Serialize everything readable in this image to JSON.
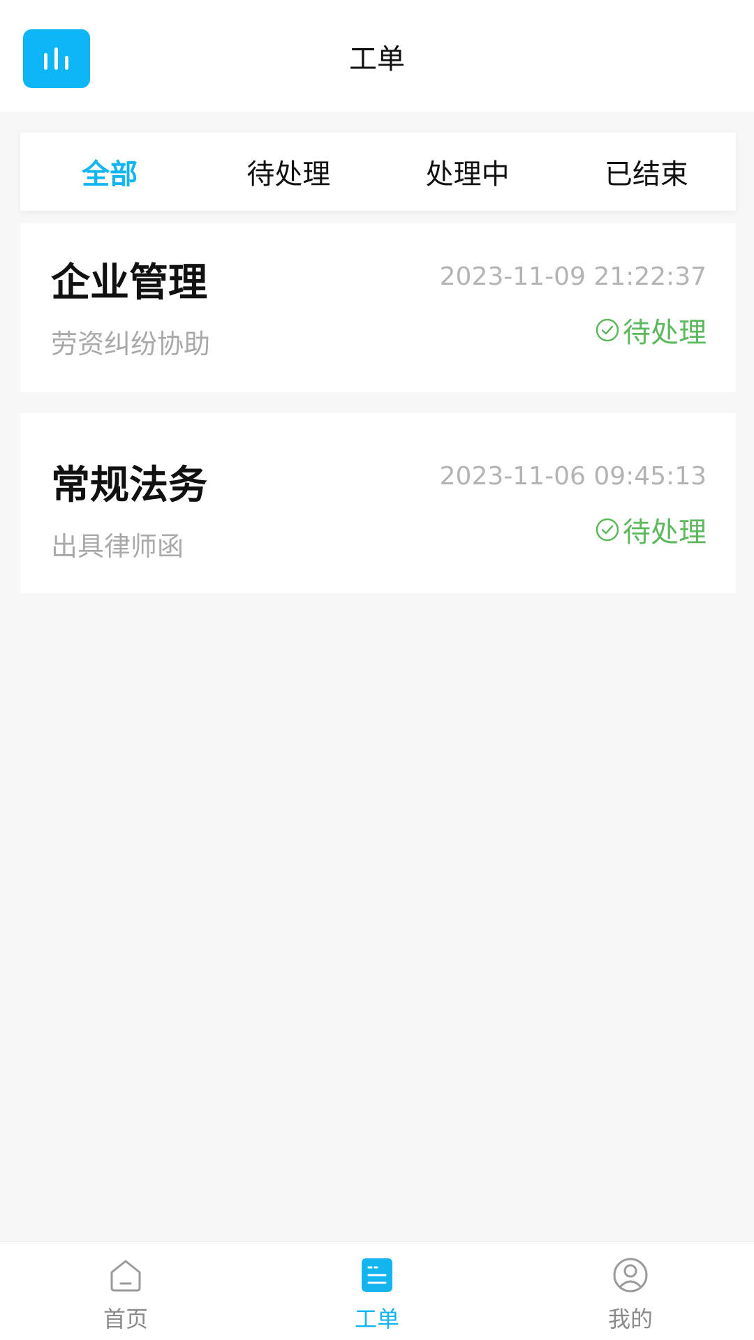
{
  "header": {
    "title": "工单",
    "logo_icon": "bar-chart-icon",
    "accent_color": "#0fb6f5"
  },
  "tabs": [
    {
      "label": "全部",
      "active": true
    },
    {
      "label": "待处理",
      "active": false
    },
    {
      "label": "处理中",
      "active": false
    },
    {
      "label": "已结束",
      "active": false
    }
  ],
  "orders": [
    {
      "title": "企业管理",
      "subtitle": "劳资纠纷协助",
      "time": "2023-11-09 21:22:37",
      "status": "待处理",
      "status_icon": "check-circle-icon",
      "status_color": "#5cb85c"
    },
    {
      "title": "常规法务",
      "subtitle": "出具律师函",
      "time": "2023-11-06 09:45:13",
      "status": "待处理",
      "status_icon": "check-circle-icon",
      "status_color": "#5cb85c"
    }
  ],
  "bottom_nav": [
    {
      "label": "首页",
      "icon": "home-icon",
      "active": false
    },
    {
      "label": "工单",
      "icon": "document-list-icon",
      "active": true
    },
    {
      "label": "我的",
      "icon": "user-circle-icon",
      "active": false
    }
  ]
}
